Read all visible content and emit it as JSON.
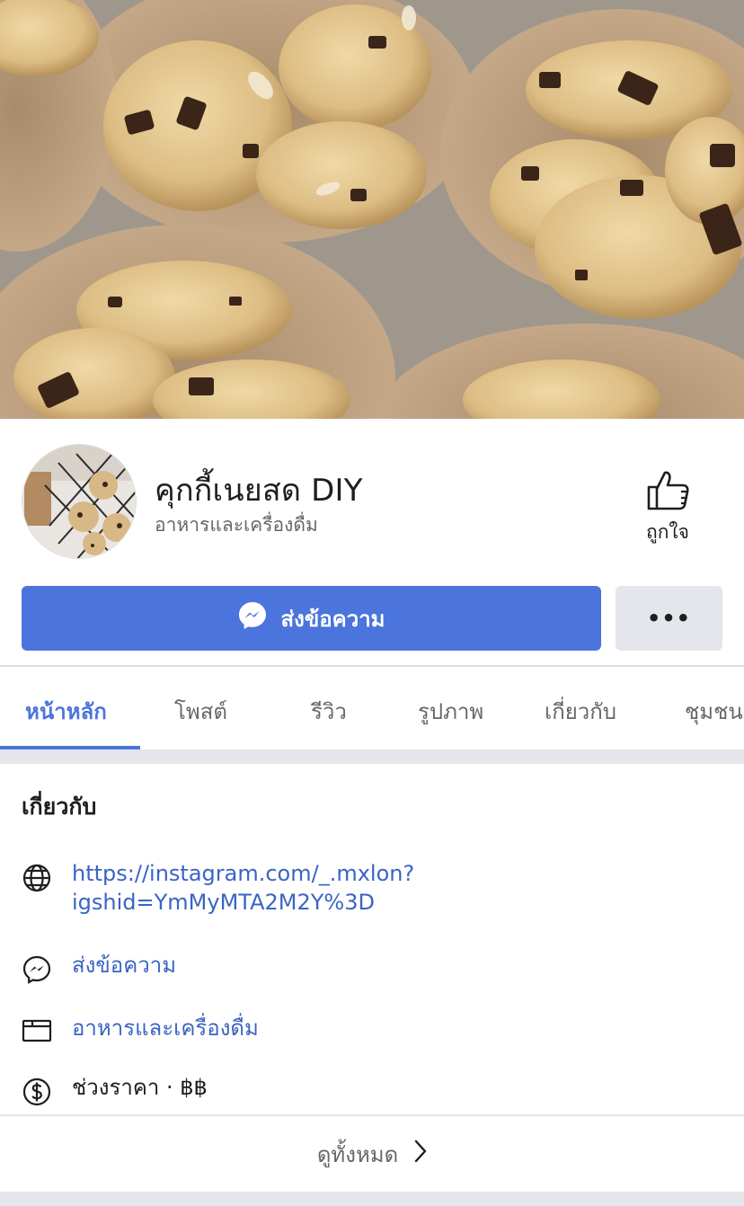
{
  "page": {
    "name": "คุกกี้เนยสด DIY",
    "category": "อาหารและเครื่องดื่ม",
    "like_label": "ถูกใจ"
  },
  "actions": {
    "message_label": "ส่งข้อความ",
    "more_label": "•••"
  },
  "tabs": [
    {
      "label": "หน้าหลัก",
      "active": true
    },
    {
      "label": "โพสต์",
      "active": false
    },
    {
      "label": "รีวิว",
      "active": false
    },
    {
      "label": "รูปภาพ",
      "active": false
    },
    {
      "label": "เกี่ยวกับ",
      "active": false
    },
    {
      "label": "ชุมชน",
      "active": false
    }
  ],
  "about": {
    "title": "เกี่ยวกับ",
    "website": "https://instagram.com/_.mxlon?igshid=YmMyMTA2M2Y%3D",
    "website_line1": "https://instagram.com/_.mxlon?",
    "website_line2": "igshid=YmMyMTA2M2Y%3D",
    "message": "ส่งข้อความ",
    "category": "อาหารและเครื่องดื่ม",
    "price_range": "ช่วงราคา · ฿฿",
    "see_all": "ดูทั้งหมด"
  },
  "colors": {
    "accent": "#4b74dd",
    "link": "#3a64c4",
    "secondary_text": "#65676b",
    "separator": "#e4e6eb"
  },
  "icons": {
    "like": "thumbs-up-icon",
    "messenger": "messenger-icon",
    "website": "globe-icon",
    "category": "folder-icon",
    "price": "dollar-icon",
    "chevron": "chevron-right-icon"
  }
}
